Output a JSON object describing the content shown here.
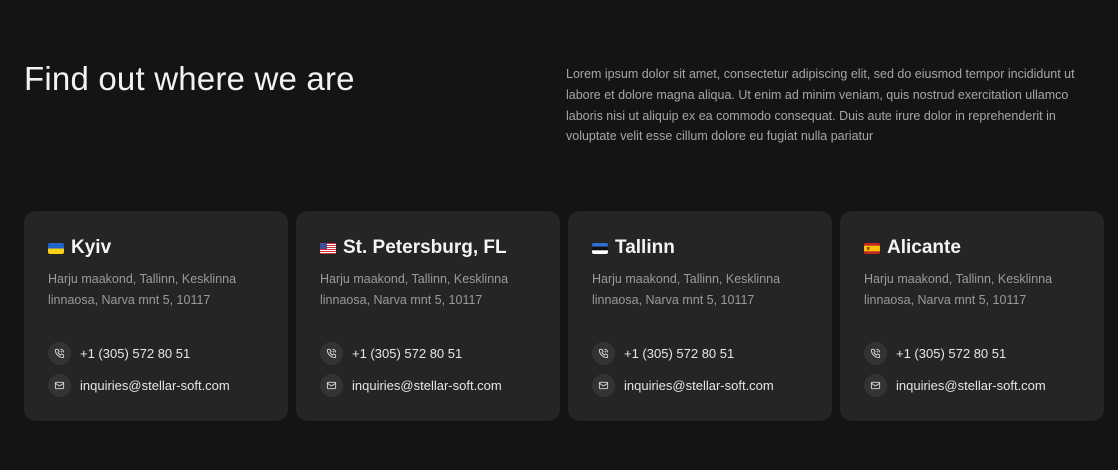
{
  "section": {
    "title": "Find out where we are",
    "description": "Lorem ipsum dolor sit amet, consectetur adipiscing elit, sed do eiusmod tempor incididunt ut labore et dolore magna aliqua. Ut enim ad minim veniam, quis nostrud exercitation ullamco laboris nisi ut aliquip ex ea commodo consequat. Duis aute irure dolor in reprehenderit in voluptate velit esse cillum dolore eu fugiat nulla pariatur"
  },
  "offices": [
    {
      "flag_icon": "flag-ukraine-icon",
      "city": "Kyiv",
      "address": "Harju maakond, Tallinn, Kesklinna linnaosa, Narva mnt 5, 10117",
      "phone": "+1 (305) 572 80 51",
      "email": "inquiries@stellar-soft.com"
    },
    {
      "flag_icon": "flag-usa-icon",
      "city": "St. Petersburg, FL",
      "address": "Harju maakond, Tallinn, Kesklinna linnaosa, Narva mnt 5, 10117",
      "phone": "+1 (305) 572 80 51",
      "email": "inquiries@stellar-soft.com"
    },
    {
      "flag_icon": "flag-estonia-icon",
      "city": "Tallinn",
      "address": "Harju maakond, Tallinn, Kesklinna linnaosa, Narva mnt 5, 10117",
      "phone": "+1 (305) 572 80 51",
      "email": "inquiries@stellar-soft.com"
    },
    {
      "flag_icon": "flag-spain-icon",
      "city": "Alicante",
      "address": "Harju maakond, Tallinn, Kesklinna linnaosa, Narva mnt 5, 10117",
      "phone": "+1 (305) 572 80 51",
      "email": "inquiries@stellar-soft.com"
    }
  ],
  "colors": {
    "background": "#141414",
    "card": "#252525",
    "icon_circle": "#333333",
    "text_muted": "#9a9a9a"
  }
}
